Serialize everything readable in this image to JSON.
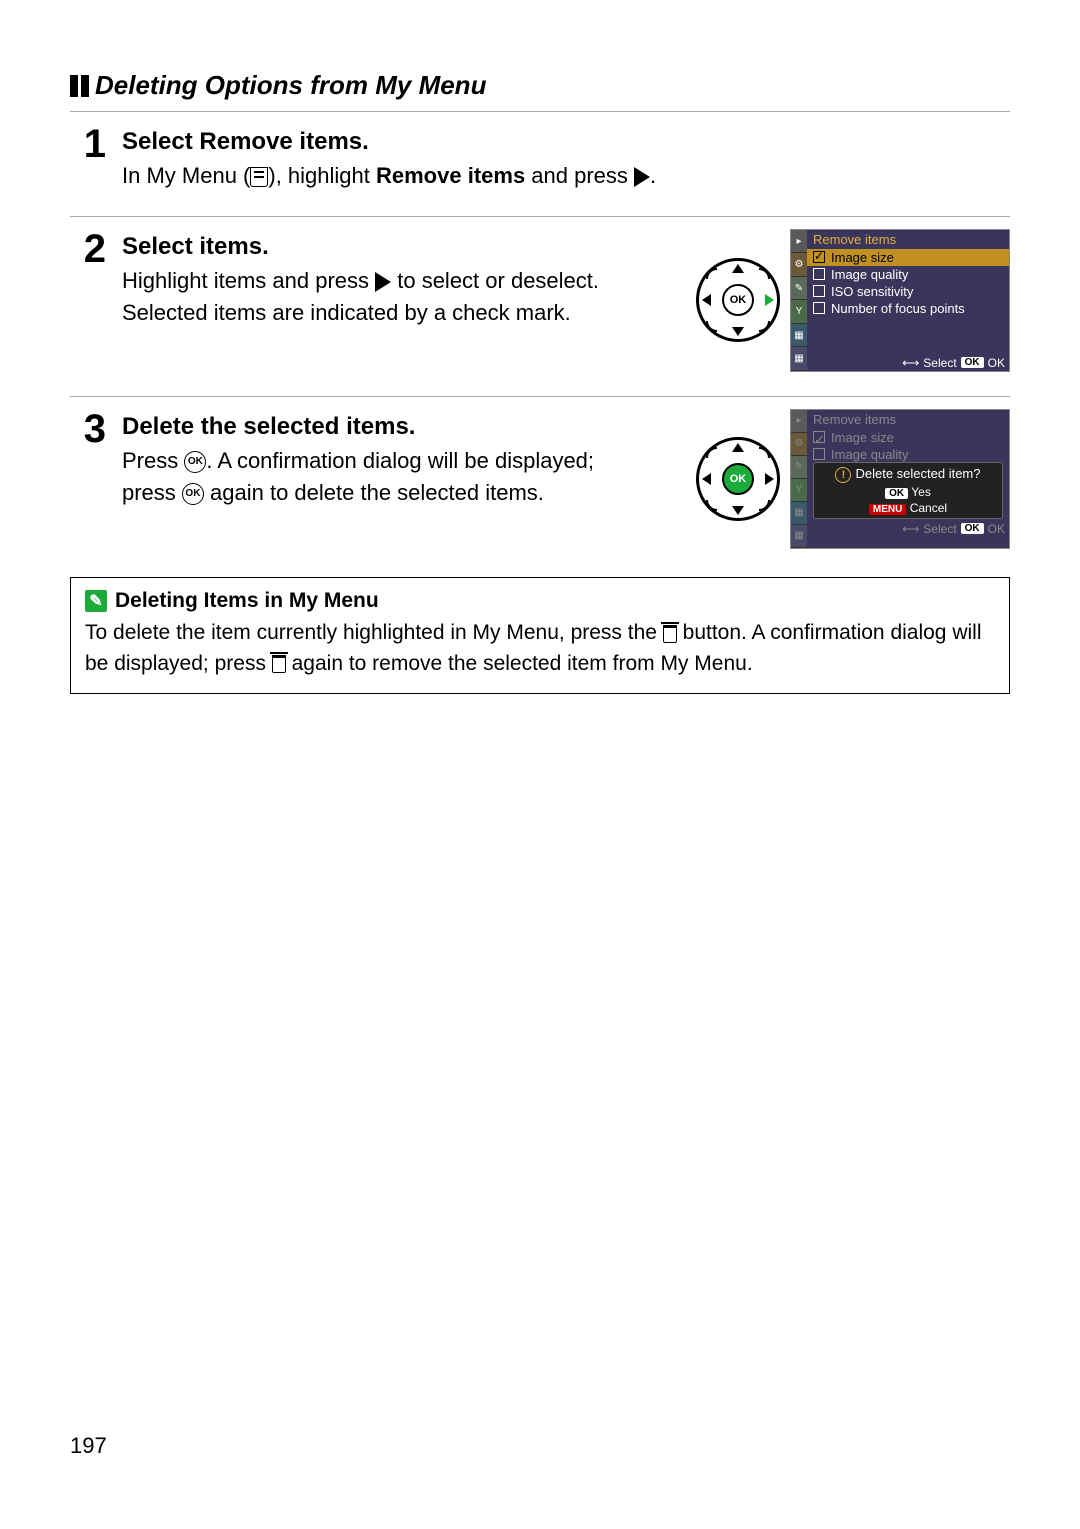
{
  "page_number": "197",
  "section_title": "Deleting Options from My Menu",
  "steps": [
    {
      "num": "1",
      "head_prefix": "Select ",
      "head_bold": "Remove items",
      "head_suffix": ".",
      "text_a": "In My Menu (",
      "text_b": "), highlight ",
      "text_bold": "Remove items",
      "text_c": " and press ",
      "text_d": "."
    },
    {
      "num": "2",
      "head": "Select items.",
      "text_a": "Highlight items and press ",
      "text_b": " to select or deselect.  Selected items are indicated by a check mark."
    },
    {
      "num": "3",
      "head": "Delete the selected items.",
      "text_a": "Press ",
      "text_b": ".  A confirmation dialog will be displayed; press ",
      "text_c": " again to delete the selected items."
    }
  ],
  "lcd1": {
    "title": "Remove items",
    "rows": [
      {
        "label": "Image size",
        "checked": true,
        "selected": true
      },
      {
        "label": "Image quality",
        "checked": false,
        "selected": false
      },
      {
        "label": "ISO sensitivity",
        "checked": false,
        "selected": false
      },
      {
        "label": "Number of focus points",
        "checked": false,
        "selected": false
      }
    ],
    "foot_select": "Select",
    "foot_ok": "OK",
    "ok_pill": "OK",
    "move_glyph": "⟷"
  },
  "lcd2": {
    "title": "Remove items",
    "rows": [
      {
        "label": "Image size",
        "checked": true
      },
      {
        "label": "Image quality",
        "checked": false
      }
    ],
    "dialog_question": "Delete selected item?",
    "dialog_yes": "Yes",
    "dialog_cancel": "Cancel",
    "ok_pill": "OK",
    "menu_pill": "MENU",
    "foot_select": "Select",
    "foot_ok": "OK",
    "move_glyph": "⟷"
  },
  "note": {
    "title": "Deleting Items in My Menu",
    "text_a": "To delete the item currently highlighted in My Menu, press the ",
    "text_b": " button.  A confirmation dialog will be displayed; press ",
    "text_c": " again to remove the selected item from My Menu."
  },
  "ok_label": "OK"
}
